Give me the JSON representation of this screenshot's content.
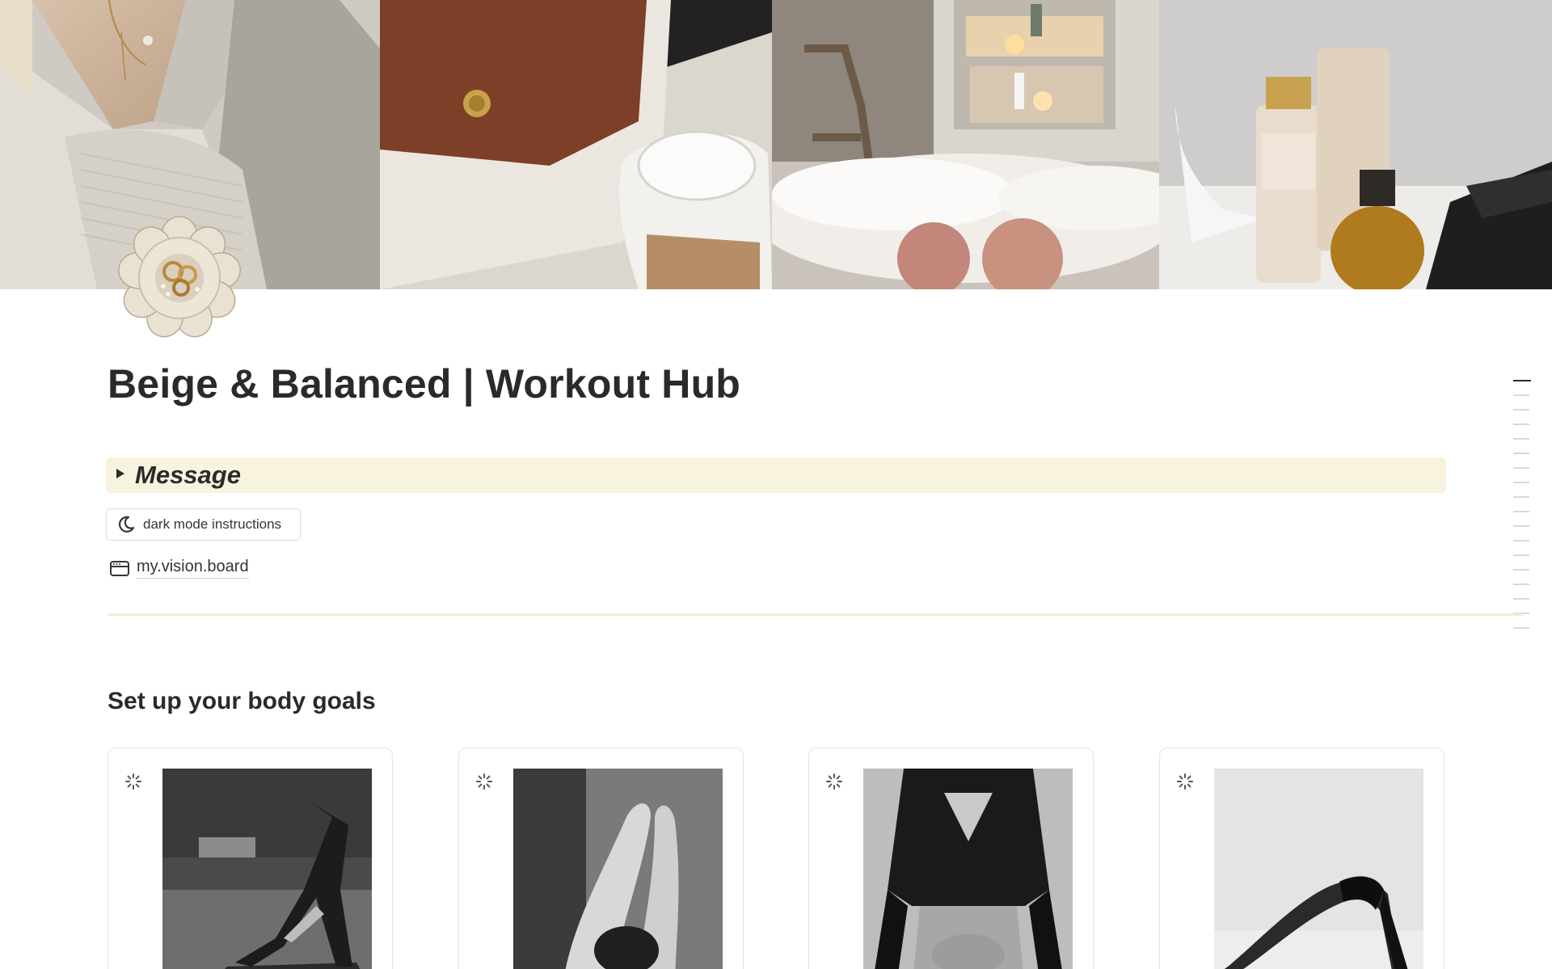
{
  "page": {
    "title": "Beige & Balanced | Workout Hub",
    "icon": "jewelry-dish-icon"
  },
  "cover": {
    "panels": [
      "sweater-photo",
      "tote-bag-coffee-photo",
      "bath-photo",
      "perfume-vanity-photo"
    ]
  },
  "toggle": {
    "label": "Message",
    "arrow_icon": "triangle-right-icon",
    "background": "#f8f3df"
  },
  "dark_mode_button": {
    "label": "dark mode instructions",
    "icon": "moon-icon"
  },
  "vision_board_link": {
    "label": "my.vision.board",
    "icon": "browser-window-icon"
  },
  "divider": {
    "color": "#eeefd9"
  },
  "section": {
    "heading": "Set up your body goals",
    "cards": [
      {
        "image": "downward-dog-photo",
        "icon": "loading-spinner-icon"
      },
      {
        "image": "backbend-photo",
        "icon": "loading-spinner-icon"
      },
      {
        "image": "crop-top-torso-photo",
        "icon": "loading-spinner-icon"
      },
      {
        "image": "wheel-pose-photo",
        "icon": "loading-spinner-icon"
      }
    ]
  },
  "outline": {
    "active_index": 0,
    "count": 18
  }
}
